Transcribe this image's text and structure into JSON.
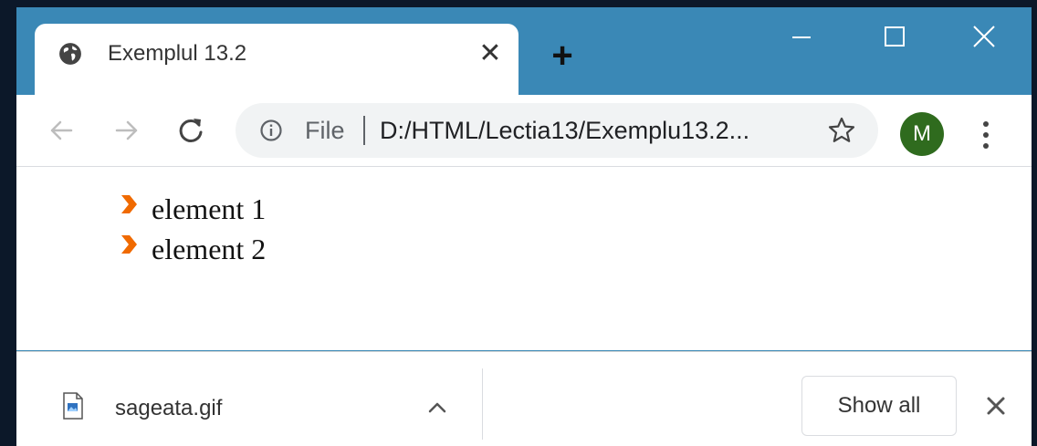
{
  "tab": {
    "title": "Exemplul 13.2",
    "close_glyph": "✕"
  },
  "new_tab_glyph": "+",
  "address_bar": {
    "scheme_label": "File",
    "url": "D:/HTML/Lectia13/Exemplu13.2..."
  },
  "profile": {
    "initial": "M",
    "color": "#2f6b1e"
  },
  "page": {
    "items": [
      {
        "label": "element 1",
        "bullet_icon": "orange-chevron-right"
      },
      {
        "label": "element 2",
        "bullet_icon": "orange-chevron-right"
      }
    ]
  },
  "download_shelf": {
    "file_name": "sageata.gif",
    "show_all_label": "Show all"
  },
  "colors": {
    "title_bar": "#3a88b6",
    "bullet": "#f06a00",
    "background": "#0c1829"
  }
}
